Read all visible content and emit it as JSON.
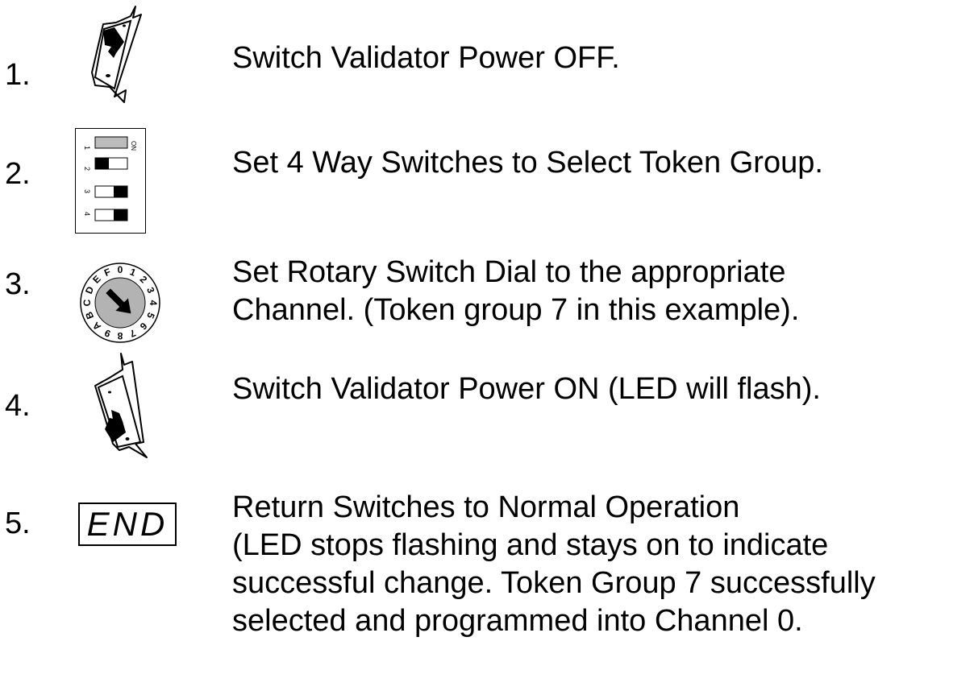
{
  "steps": [
    {
      "number": "1.",
      "icon": "toggle-switch-off-icon",
      "text": [
        "Switch Validator Power OFF."
      ]
    },
    {
      "number": "2.",
      "icon": "dip-switch-icon",
      "text": [
        "Set 4 Way Switches to Select Token Group."
      ],
      "dip_switch": {
        "on_label": "ON",
        "switches": [
          {
            "label": "1",
            "state": "grey"
          },
          {
            "label": "2",
            "state": "left"
          },
          {
            "label": "3",
            "state": "right"
          },
          {
            "label": "4",
            "state": "right"
          }
        ]
      }
    },
    {
      "number": "3.",
      "icon": "rotary-dial-icon",
      "text": [
        "Set Rotary Switch Dial to the appropriate",
        "Channel.  (Token group 7 in this example)."
      ],
      "rotary_dial": {
        "positions": [
          "0",
          "1",
          "2",
          "3",
          "4",
          "5",
          "6",
          "7",
          "8",
          "9",
          "A",
          "B",
          "C",
          "D",
          "E",
          "F"
        ],
        "selected": "7"
      }
    },
    {
      "number": "4.",
      "icon": "toggle-switch-on-icon",
      "text": [
        "Switch Validator Power ON (LED will flash)."
      ]
    },
    {
      "number": "5.",
      "icon": "end-box",
      "end_label": "END",
      "text": [
        "Return Switches to Normal Operation",
        "(LED stops flashing and stays on to indicate",
        "successful change. Token Group 7 successfully",
        "selected and programmed into Channel 0."
      ]
    }
  ]
}
